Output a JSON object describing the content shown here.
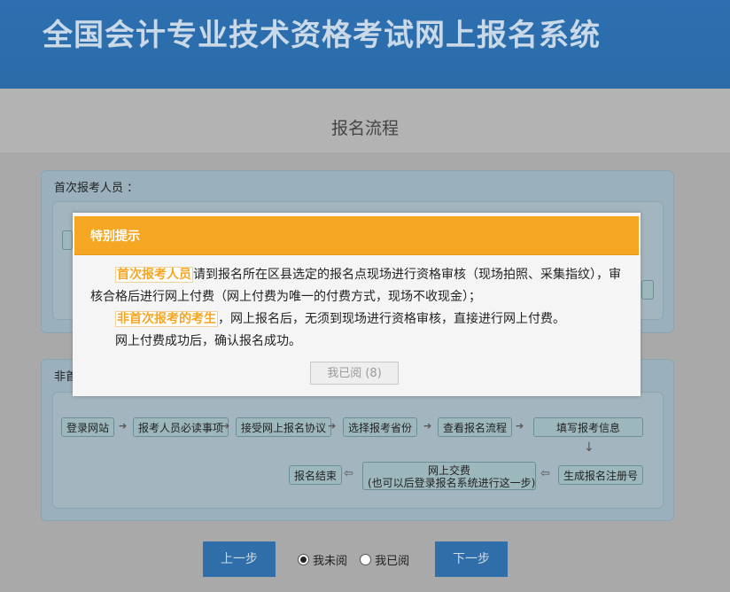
{
  "header": {
    "title": "全国会计专业技术资格考试网上报名系统"
  },
  "page_subtitle": "报名流程",
  "panels": {
    "first_time": {
      "title": "首次报考人员 ："
    },
    "non_first_time": {
      "title_prefix": "非首"
    }
  },
  "flow": {
    "steps": [
      "登录网站",
      "报考人员必读事项",
      "接受网上报名协议",
      "选择报考省份",
      "查看报名流程",
      "填写报考信息",
      "生成报名注册号",
      "网上交费",
      "(也可以后登录报名系统进行这一步)",
      "报名结束"
    ],
    "arrow_right": "➔",
    "arrow_down": "↓",
    "arrow_left": "⇦"
  },
  "modal": {
    "title": "特别提示",
    "highlight_first": "首次报考人员",
    "text_first": "请到报名所在区县选定的报名点现场进行资格审核（现场拍照、采集指纹），审核合格后进行网上付费（网上付费为唯一的付费方式，现场不收现金）；",
    "highlight_second": "非首次报考的考生",
    "text_second": "，网上报名后，无须到现场进行资格审核，直接进行网上付费。",
    "text_third": "网上付费成功后，确认报名成功。",
    "ack_button": "我已阅 (8)"
  },
  "footer": {
    "prev_button": "上一步",
    "next_button": "下一步",
    "radio_unread": "我未阅",
    "radio_read": "我已阅",
    "selected": "unread"
  },
  "colors": {
    "header_bg": "#2d6fb0",
    "modal_header": "#f5a623",
    "highlight": "#f5a623",
    "nav_button": "#2f6ea8"
  }
}
